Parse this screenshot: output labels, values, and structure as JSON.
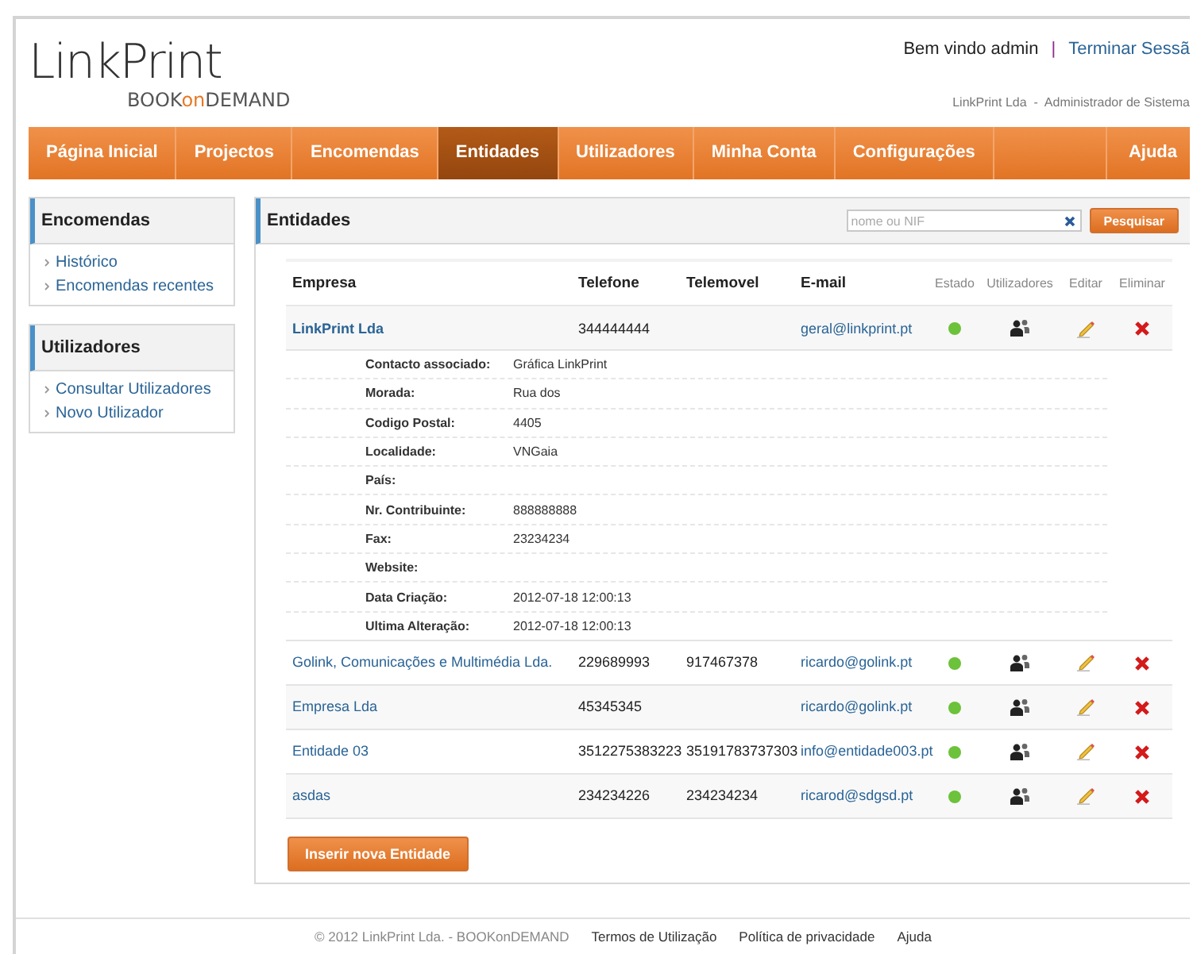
{
  "header": {
    "logo": "LinkPrint",
    "tagline": [
      {
        "text": "BOOK",
        "accent": false
      },
      {
        "text": "on",
        "accent": true
      },
      {
        "text": "DEMAND",
        "accent": false
      }
    ],
    "welcome": "Bem vindo admin",
    "separator": "|",
    "logout": "Terminar Sessã",
    "subtitle": "LinkPrint Lda  -  Administrador de Sistema"
  },
  "nav": [
    {
      "label": "Página Inicial",
      "selected": false
    },
    {
      "label": "Projectos",
      "selected": false
    },
    {
      "label": "Encomendas",
      "selected": false
    },
    {
      "label": "Entidades",
      "selected": true
    },
    {
      "label": "Utilizadores",
      "selected": false
    },
    {
      "label": "Minha Conta",
      "selected": false
    },
    {
      "label": "Configurações",
      "selected": false
    }
  ],
  "nav_help": "Ajuda",
  "sidebar": [
    {
      "title": "Encomendas",
      "links": [
        "Histórico",
        "Encomendas recentes"
      ]
    },
    {
      "title": "Utilizadores",
      "links": [
        "Consultar Utilizadores",
        "Novo Utilizador"
      ]
    }
  ],
  "panel": {
    "title": "Entidades",
    "search": {
      "placeholder": "nome ou NIF"
    },
    "search_button": "Pesquisar",
    "columns": [
      {
        "label": "Empresa",
        "kind": "data"
      },
      {
        "label": "Telefone",
        "kind": "data"
      },
      {
        "label": "Telemovel",
        "kind": "data"
      },
      {
        "label": "E-mail",
        "kind": "data"
      },
      {
        "label": "Estado",
        "kind": "action"
      },
      {
        "label": "Utilizadores",
        "kind": "action"
      },
      {
        "label": "Editar",
        "kind": "action"
      },
      {
        "label": "Eliminar",
        "kind": "action"
      }
    ],
    "rows": [
      {
        "empresa": "LinkPrint Lda",
        "telefone": "344444444",
        "email": "geral@linkprint.pt",
        "active": true,
        "expanded": true,
        "details": [
          {
            "label": "Contacto associado:",
            "value": "Gráfica LinkPrint"
          },
          {
            "label": "Morada:",
            "value": "Rua dos"
          },
          {
            "label": "Codigo Postal:",
            "value": "4405"
          },
          {
            "label": "Localidade:",
            "value": "VNGaia"
          },
          {
            "label": "País:"
          },
          {
            "label": "Nr. Contribuinte:",
            "value": "888888888"
          },
          {
            "label": "Fax:",
            "value": "23234234"
          },
          {
            "label": "Website:"
          },
          {
            "label": "Data Criação:",
            "value": "2012-07-18 12:00:13"
          },
          {
            "label": "Ultima Alteração:",
            "value": "2012-07-18 12:00:13"
          }
        ]
      },
      {
        "empresa": "Golink, Comunicações e Multimédia Lda.",
        "telefone": "229689993",
        "telemovel": "917467378",
        "email": "ricardo@golink.pt",
        "active": true,
        "expanded": false
      },
      {
        "empresa": "Empresa Lda",
        "telefone": "45345345",
        "email": "ricardo@golink.pt",
        "active": true,
        "expanded": false
      },
      {
        "empresa": "Entidade 03",
        "telefone": "3512275383223",
        "telemovel": "35191783737303",
        "email": "info@entidade003.pt",
        "active": true,
        "expanded": false
      },
      {
        "empresa": "asdas",
        "telefone": "234234226",
        "telemovel": "234234234",
        "email": "ricarod@sdgsd.pt",
        "active": true,
        "expanded": false
      }
    ],
    "insert_button": "Inserir nova Entidade"
  },
  "footer": {
    "copyright": "© 2012 LinkPrint Lda. - BOOKonDEMAND",
    "links": [
      "Termos de Utilização",
      "Política de privacidade",
      "Ajuda"
    ]
  }
}
